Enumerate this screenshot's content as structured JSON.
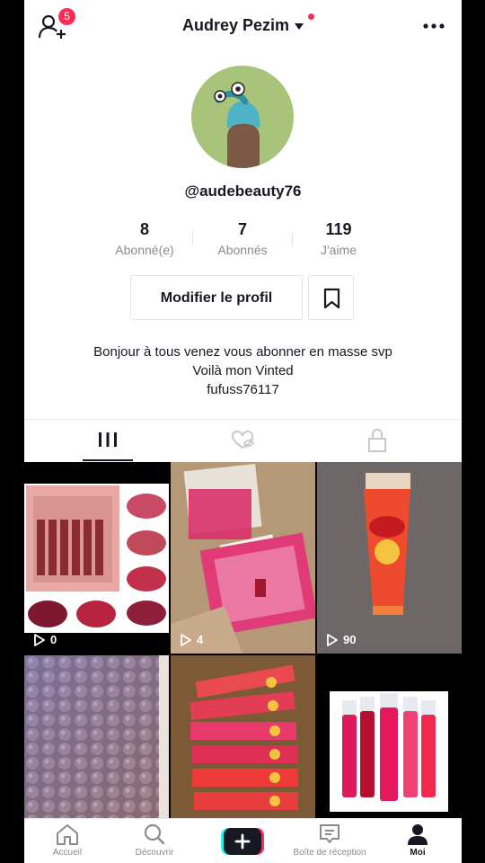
{
  "header": {
    "title": "Audrey Pezim",
    "notification_count": "5"
  },
  "profile": {
    "handle": "@audebeauty76",
    "stats": [
      {
        "value": "8",
        "label": "Abonné(e)"
      },
      {
        "value": "7",
        "label": "Abonnés"
      },
      {
        "value": "119",
        "label": "J'aime"
      }
    ],
    "edit_label": "Modifier le profil",
    "bio": [
      "Bonjour à tous venez vous abonner en masse svp",
      "Voilà mon Vinted",
      "fufuss76117"
    ]
  },
  "tabs": [
    {
      "icon": "grid-icon",
      "active": true
    },
    {
      "icon": "liked-hidden-icon",
      "active": false
    },
    {
      "icon": "lock-icon",
      "active": false
    }
  ],
  "videos": [
    {
      "views": "0"
    },
    {
      "views": "4"
    },
    {
      "views": "90"
    },
    {
      "views": ""
    },
    {
      "views": ""
    },
    {
      "views": ""
    }
  ],
  "nav": {
    "items": [
      {
        "label": "Accueil",
        "icon": "home-icon"
      },
      {
        "label": "Découvrir",
        "icon": "search-icon"
      },
      {
        "label": "",
        "icon": "plus-icon"
      },
      {
        "label": "Boîte de réception",
        "icon": "inbox-icon"
      },
      {
        "label": "Moi",
        "icon": "profile-icon"
      }
    ]
  },
  "colors": {
    "accent": "#fe2c55",
    "text": "#161823",
    "muted": "#8a8b91"
  }
}
